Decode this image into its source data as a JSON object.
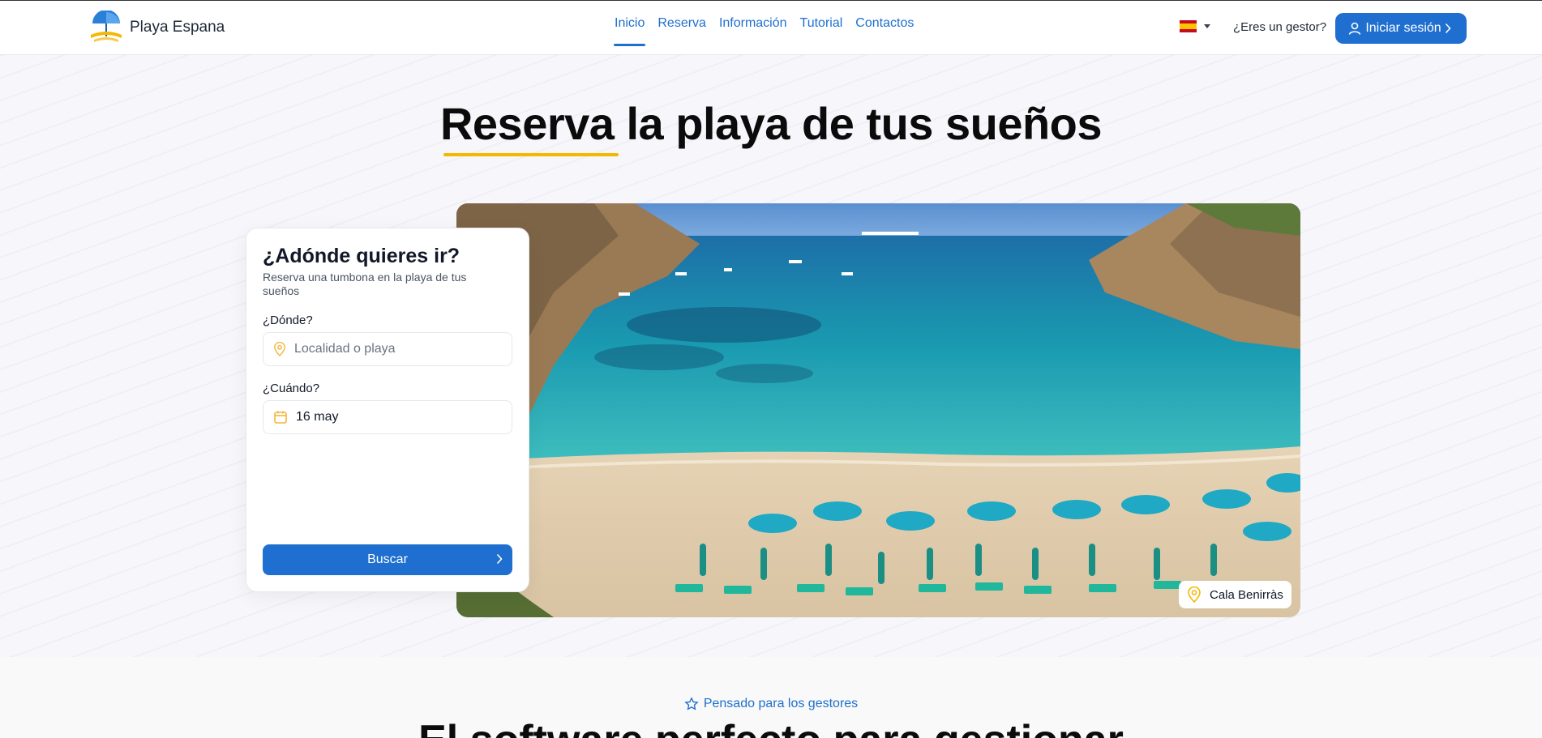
{
  "header": {
    "brand": "Playa Espana",
    "nav": [
      {
        "label": "Inicio",
        "active": true
      },
      {
        "label": "Reserva",
        "active": false
      },
      {
        "label": "Información",
        "active": false
      },
      {
        "label": "Tutorial",
        "active": false
      },
      {
        "label": "Contactos",
        "active": false
      }
    ],
    "language": "es",
    "manager_question": "¿Eres un gestor?",
    "login_label": "Iniciar sesión"
  },
  "hero": {
    "title": "Reserva la playa de tus sueños",
    "photo_location": "Cala Benirràs"
  },
  "search_card": {
    "title": "¿Adónde quieres ir?",
    "subtitle": "Reserva una tumbona en la playa de tus sueños",
    "where_label": "¿Dónde?",
    "where_placeholder": "Localidad o playa",
    "when_label": "¿Cuándo?",
    "when_value": "16 may",
    "search_button": "Buscar"
  },
  "section2": {
    "eyebrow": "Pensado para los gestores",
    "title": "El software perfecto para gestionar"
  },
  "colors": {
    "primary": "#1e6fcf",
    "accent": "#f5b800",
    "icon_accent": "#f5b53d"
  }
}
